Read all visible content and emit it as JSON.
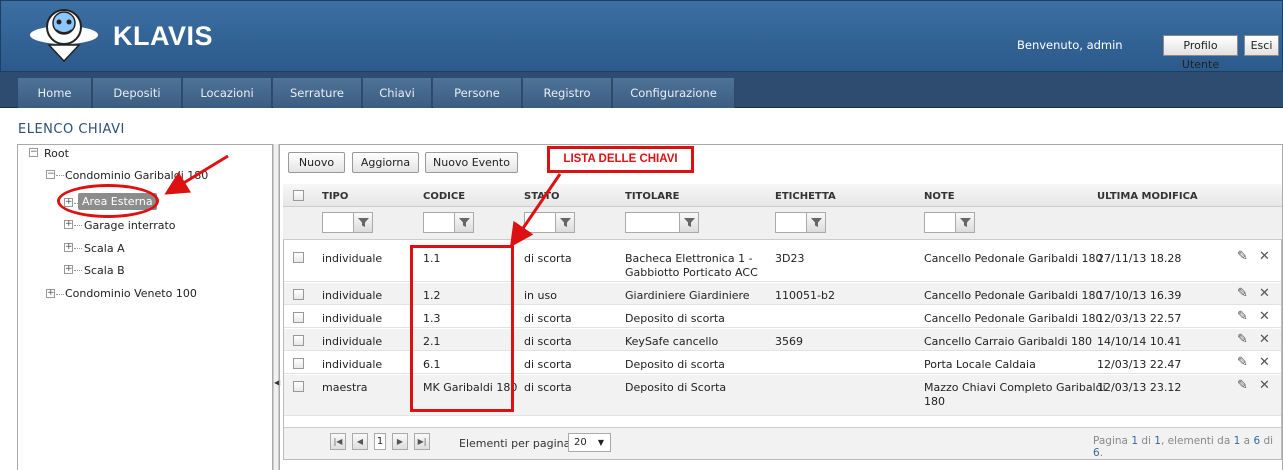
{
  "app": {
    "brand": "KLAVIS",
    "welcome": "Benvenuto, admin",
    "profile_label": "Profilo Utente",
    "exit_label": "Esci"
  },
  "nav": {
    "items": [
      "Home",
      "Depositi",
      "Locazioni",
      "Serrature",
      "Chiavi",
      "Persone",
      "Registro",
      "Configurazione"
    ]
  },
  "page_title": "Elenco Chiavi",
  "tree": {
    "root": "Root",
    "n1": "Condominio Garibaldi 180",
    "n1a": "Area Esterna",
    "n1b": "Garage interrato",
    "n1c": "Scala A",
    "n1d": "Scala B",
    "n2": "Condominio Veneto 100"
  },
  "toolbar": {
    "new_label": "Nuovo",
    "refresh_label": "Aggiorna",
    "new_event_label": "Nuovo Evento"
  },
  "annotation": {
    "label": "LISTA DELLE CHIAVI"
  },
  "table": {
    "columns": [
      "TIPO",
      "CODICE",
      "STATO",
      "TITOLARE",
      "ETICHETTA",
      "NOTE",
      "ULTIMA MODIFICA"
    ],
    "rows": [
      {
        "tipo": "individuale",
        "codice": "1.1",
        "stato": "di scorta",
        "titolare": "Bacheca Elettronica 1 -",
        "titolare2": "Gabbiotto Porticato ACC",
        "etichetta": "3D23",
        "note": "Cancello Pedonale Garibaldi 180",
        "note2": "",
        "modifica": "27/11/13 18.28"
      },
      {
        "tipo": "individuale",
        "codice": "1.2",
        "stato": "in uso",
        "titolare": "Giardiniere Giardiniere",
        "titolare2": "",
        "etichetta": "110051-b2",
        "note": "Cancello Pedonale Garibaldi 180",
        "note2": "",
        "modifica": "17/10/13 16.39"
      },
      {
        "tipo": "individuale",
        "codice": "1.3",
        "stato": "di scorta",
        "titolare": "Deposito di scorta",
        "titolare2": "",
        "etichetta": "",
        "note": "Cancello Pedonale Garibaldi 180",
        "note2": "",
        "modifica": "12/03/13 22.57"
      },
      {
        "tipo": "individuale",
        "codice": "2.1",
        "stato": "di scorta",
        "titolare": "KeySafe cancello",
        "titolare2": "",
        "etichetta": "3569",
        "note": "Cancello Carraio Garibaldi 180",
        "note2": "",
        "modifica": "14/10/14 10.41"
      },
      {
        "tipo": "individuale",
        "codice": "6.1",
        "stato": "di scorta",
        "titolare": "Deposito di scorta",
        "titolare2": "",
        "etichetta": "",
        "note": "Porta Locale Caldaia",
        "note2": "",
        "modifica": "12/03/13 22.47"
      },
      {
        "tipo": "maestra",
        "codice": "MK Garibaldi 180",
        "stato": "di scorta",
        "titolare": "Deposito di Scorta",
        "titolare2": "",
        "etichetta": "",
        "note": "Mazzo Chiavi Completo Garibaldi",
        "note2": "180",
        "modifica": "12/03/13 23.12"
      }
    ]
  },
  "pager": {
    "page": "1",
    "per_page_label": "Elementi per pagina:",
    "per_page": "20",
    "info_a": "Pagina ",
    "info_b": "1",
    "info_c": " di ",
    "info_d": "1",
    "info_e": ", elementi da ",
    "info_f": "1",
    "info_g": " a ",
    "info_h": "6",
    "info_i": " di ",
    "info_j": "6",
    "info_k": "."
  },
  "colors": {
    "header": "#2b5a8b",
    "nav": "#2e4c70",
    "annotation": "#dd1111"
  }
}
